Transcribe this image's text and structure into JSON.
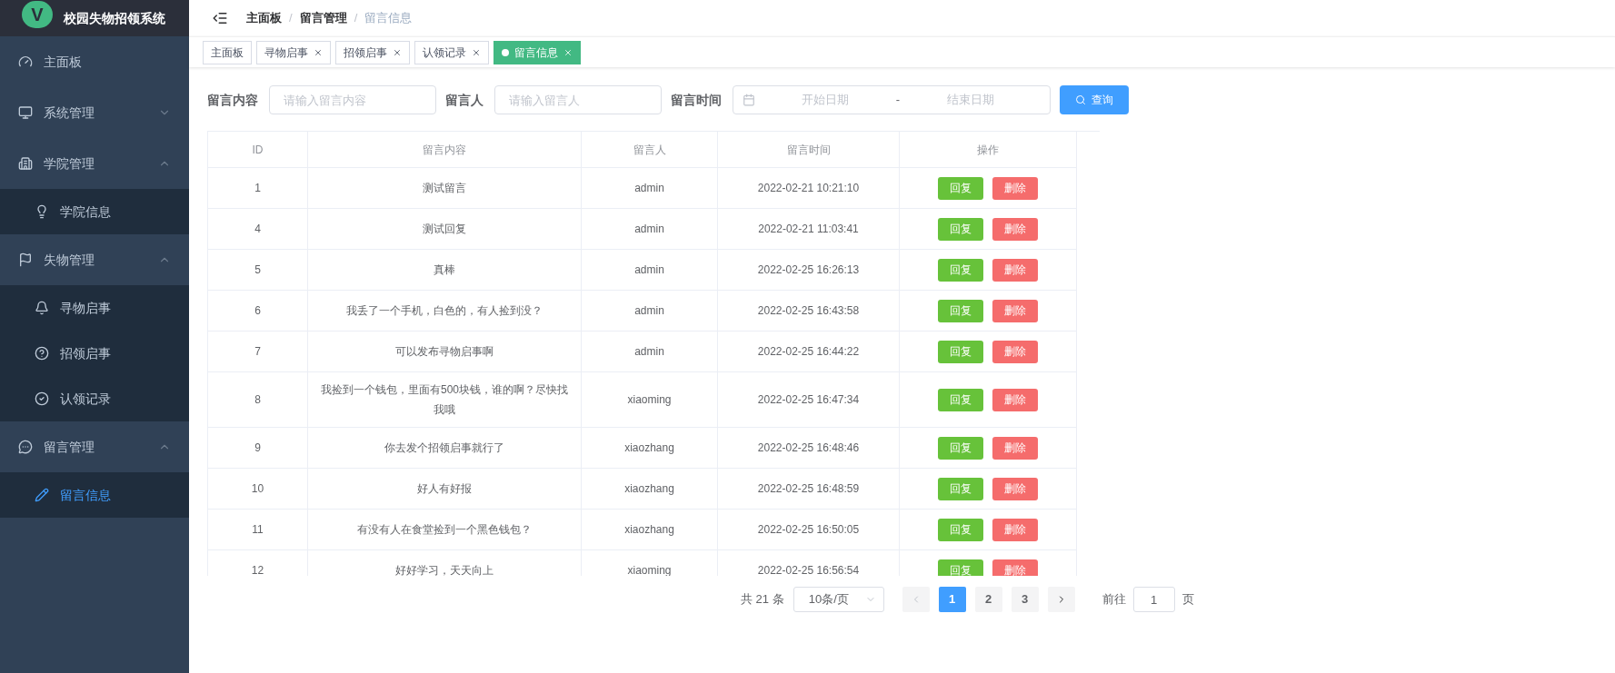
{
  "app": {
    "logo_letter": "V",
    "title": "校园失物招领系统"
  },
  "sidebar": {
    "items": [
      {
        "kind": "link",
        "label": "主面板",
        "selected": false
      },
      {
        "kind": "group",
        "label": "系统管理",
        "expanded": false
      },
      {
        "kind": "group",
        "label": "学院管理",
        "expanded": true,
        "children": [
          {
            "label": "学院信息",
            "selected": false
          }
        ]
      },
      {
        "kind": "group",
        "label": "失物管理",
        "expanded": true,
        "children": [
          {
            "label": "寻物启事",
            "selected": false
          },
          {
            "label": "招领启事",
            "selected": false
          },
          {
            "label": "认领记录",
            "selected": false
          }
        ]
      },
      {
        "kind": "group",
        "label": "留言管理",
        "expanded": true,
        "children": [
          {
            "label": "留言信息",
            "selected": true
          }
        ]
      }
    ]
  },
  "breadcrumb": [
    {
      "label": "主面板"
    },
    {
      "separator": "/",
      "label": "留言管理"
    },
    {
      "separator": "/",
      "label": "留言信息"
    }
  ],
  "tabs": [
    {
      "label": "主面板",
      "selected": false,
      "closable": false
    },
    {
      "label": "寻物启事",
      "selected": false,
      "closable": true
    },
    {
      "label": "招领启事",
      "selected": false,
      "closable": true
    },
    {
      "label": "认领记录",
      "selected": false,
      "closable": true
    },
    {
      "label": "留言信息",
      "selected": true,
      "closable": true
    }
  ],
  "filters": [
    {
      "label": "留言内容",
      "placeholder": "请输入留言内容"
    },
    {
      "label": "留言人",
      "placeholder": "请输入留言人"
    }
  ],
  "date_range": {
    "label": "留言时间",
    "start_placeholder": "开始日期",
    "separator": "-",
    "end_placeholder": "结束日期"
  },
  "search_button": "查询",
  "table": {
    "columns": [
      "ID",
      "留言内容",
      "留言人",
      "留言时间",
      "操作"
    ],
    "rows": [
      {
        "id": "1",
        "content": "测试留言",
        "author": "admin",
        "time": "2022-02-21 10:21:10",
        "actions": [
          "回复",
          "删除"
        ]
      },
      {
        "id": "4",
        "content": "测试回复",
        "author": "admin",
        "time": "2022-02-21 11:03:41",
        "actions": [
          "回复",
          "删除"
        ]
      },
      {
        "id": "5",
        "content": "真棒",
        "author": "admin",
        "time": "2022-02-25 16:26:13",
        "actions": [
          "回复",
          "删除"
        ]
      },
      {
        "id": "6",
        "content": "我丢了一个手机，白色的，有人捡到没？",
        "author": "admin",
        "time": "2022-02-25 16:43:58",
        "actions": [
          "回复",
          "删除"
        ]
      },
      {
        "id": "7",
        "content": "可以发布寻物启事啊",
        "author": "admin",
        "time": "2022-02-25 16:44:22",
        "actions": [
          "回复",
          "删除"
        ]
      },
      {
        "id": "8",
        "content": "我捡到一个钱包，里面有500块钱，谁的啊？尽快找我哦",
        "author": "xiaoming",
        "time": "2022-02-25 16:47:34",
        "actions": [
          "回复",
          "删除"
        ]
      },
      {
        "id": "9",
        "content": "你去发个招领启事就行了",
        "author": "xiaozhang",
        "time": "2022-02-25 16:48:46",
        "actions": [
          "回复",
          "删除"
        ]
      },
      {
        "id": "10",
        "content": "好人有好报",
        "author": "xiaozhang",
        "time": "2022-02-25 16:48:59",
        "actions": [
          "回复",
          "删除"
        ]
      },
      {
        "id": "11",
        "content": "有没有人在食堂捡到一个黑色钱包？",
        "author": "xiaozhang",
        "time": "2022-02-25 16:50:05",
        "actions": [
          "回复",
          "删除"
        ]
      },
      {
        "id": "12",
        "content": "好好学习，天天向上",
        "author": "xiaoming",
        "time": "2022-02-25 16:56:54",
        "actions": [
          "回复",
          "删除"
        ]
      }
    ]
  },
  "pagination": {
    "total": "共 21 条",
    "page_size": "10条/页",
    "prev_disabled": true,
    "next_disabled": false,
    "pages": [
      {
        "label": "1",
        "selected": true
      },
      {
        "label": "2",
        "selected": false
      },
      {
        "label": "3",
        "selected": false
      }
    ],
    "goto_label": "前往",
    "goto_value": "1",
    "goto_suffix": "页"
  }
}
